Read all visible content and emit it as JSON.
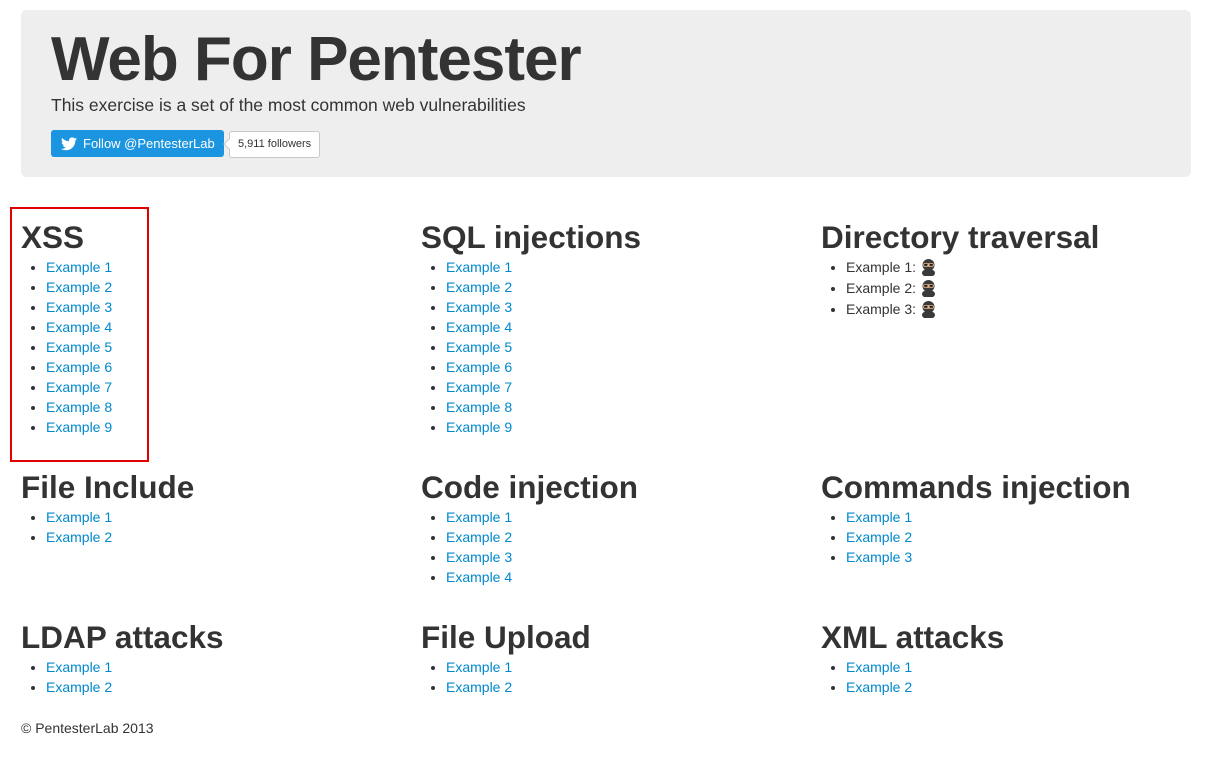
{
  "hero": {
    "title": "Web For Pentester",
    "subtitle": "This exercise is a set of the most common web vulnerabilities",
    "follow_label": "Follow @PentesterLab",
    "followers_count": "5,911 followers",
    "follow_icon": "twitter-bird-icon",
    "follow_color": "#1b95e0"
  },
  "sections": {
    "xss": {
      "title": "XSS",
      "items": [
        "Example 1",
        "Example 2",
        "Example 3",
        "Example 4",
        "Example 5",
        "Example 6",
        "Example 7",
        "Example 8",
        "Example 9"
      ]
    },
    "sql": {
      "title": "SQL injections",
      "items": [
        "Example 1",
        "Example 2",
        "Example 3",
        "Example 4",
        "Example 5",
        "Example 6",
        "Example 7",
        "Example 8",
        "Example 9"
      ]
    },
    "dir": {
      "title": "Directory traversal",
      "items": [
        "Example 1:",
        "Example 2:",
        "Example 3:"
      ],
      "item_icon": "ninja-icon"
    },
    "fileinc": {
      "title": "File Include",
      "items": [
        "Example 1",
        "Example 2"
      ]
    },
    "code": {
      "title": "Code injection",
      "items": [
        "Example 1",
        "Example 2",
        "Example 3",
        "Example 4"
      ]
    },
    "cmd": {
      "title": "Commands injection",
      "items": [
        "Example 1",
        "Example 2",
        "Example 3"
      ]
    },
    "ldap": {
      "title": "LDAP attacks",
      "items": [
        "Example 1",
        "Example 2"
      ]
    },
    "upload": {
      "title": "File Upload",
      "items": [
        "Example 1",
        "Example 2"
      ]
    },
    "xml": {
      "title": "XML attacks",
      "items": [
        "Example 1",
        "Example 2"
      ]
    }
  },
  "footer": {
    "copyright": "© PentesterLab 2013"
  },
  "colors": {
    "link": "#0088cc",
    "text": "#333333",
    "hero_background": "#eeeeee",
    "highlight": "#e00000"
  }
}
